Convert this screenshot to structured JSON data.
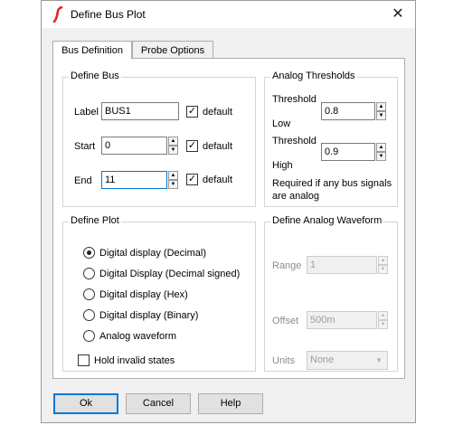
{
  "window": {
    "title": "Define Bus Plot",
    "close_glyph": "✕"
  },
  "tabs": [
    {
      "label": "Bus Definition",
      "active": true
    },
    {
      "label": "Probe Options",
      "active": false
    }
  ],
  "define_bus": {
    "title": "Define Bus",
    "label_caption": "Label",
    "label_value": "BUS1",
    "start_caption": "Start",
    "start_value": "0",
    "end_caption": "End",
    "end_value": "11",
    "default_label": "default"
  },
  "analog_thresholds": {
    "title": "Analog Thresholds",
    "threshold_caption": "Threshold",
    "low_caption": "Low",
    "low_value": "0.8",
    "high_caption": "High",
    "high_value": "0.9",
    "note": "Required if any bus signals are analog"
  },
  "define_plot": {
    "title": "Define Plot",
    "options": [
      "Digital display (Decimal)",
      "Digital Display (Decimal signed)",
      "Digital display (Hex)",
      "Digital display (Binary)",
      "Analog waveform"
    ],
    "selected_index": 0,
    "hold_invalid_label": "Hold invalid states"
  },
  "analog_waveform": {
    "title": "Define Analog Waveform",
    "range_caption": "Range",
    "range_value": "1",
    "offset_caption": "Offset",
    "offset_value": "500m",
    "units_caption": "Units",
    "units_value": "None"
  },
  "buttons": {
    "ok": "Ok",
    "cancel": "Cancel",
    "help": "Help"
  },
  "colors": {
    "accent": "#0078d7",
    "app_icon": "#e8252b"
  }
}
